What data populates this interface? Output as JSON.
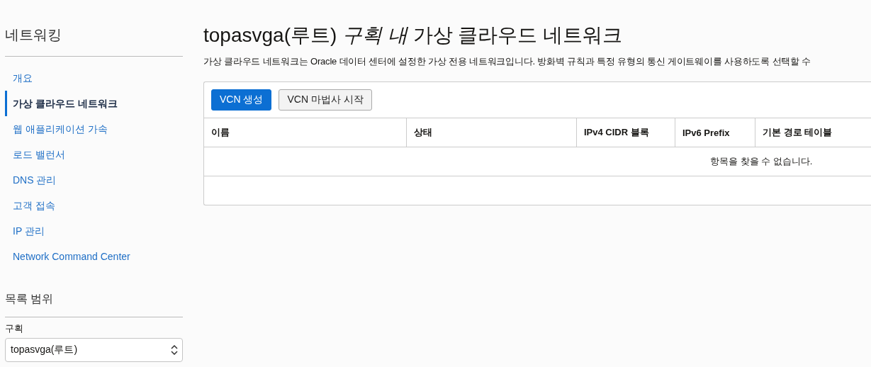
{
  "sidebar": {
    "title": "네트워킹",
    "items": [
      {
        "label": "개요",
        "selected": false
      },
      {
        "label": "가상 클라우드 네트워크",
        "selected": true
      },
      {
        "label": "웹 애플리케이션 가속",
        "selected": false
      },
      {
        "label": "로드 밸런서",
        "selected": false
      },
      {
        "label": "DNS 관리",
        "selected": false
      },
      {
        "label": "고객 접속",
        "selected": false
      },
      {
        "label": "IP 관리",
        "selected": false
      },
      {
        "label": "Network Command Center",
        "selected": false
      }
    ],
    "scope": {
      "title": "목록 범위",
      "field_label": "구획",
      "value": "topasvga(루트)"
    }
  },
  "page": {
    "title": "topasvga(루트) *구획 내* 가상 클라우드 네트워크",
    "description": "가상 클라우드 네트워크는 Oracle 데이터 센터에 설정한 가상 전용 네트워크입니다. 방화벽 규칙과 특정 유형의 통신 게이트웨이를 사용하도록 선택할 수",
    "buttons": [
      {
        "label": "VCN 생성",
        "kind": "primary"
      },
      {
        "label": "VCN 마법사 시작",
        "kind": "secondary"
      }
    ],
    "table": {
      "columns": [
        "이름",
        "상태",
        "IPv4 CIDR 블록",
        "IPv6 Prefix",
        "기본 경로 테이블"
      ],
      "empty_message": "항목을 찾을 수 없습니다."
    }
  }
}
